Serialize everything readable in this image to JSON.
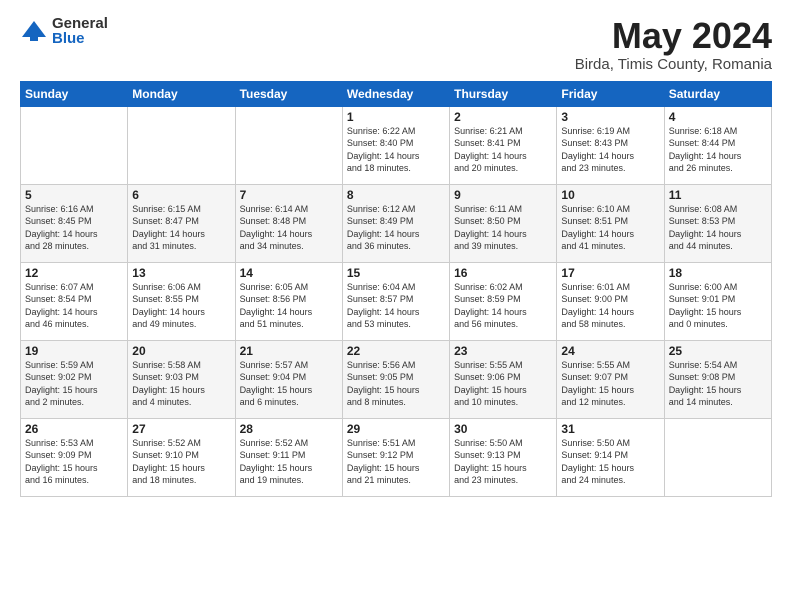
{
  "logo": {
    "general": "General",
    "blue": "Blue"
  },
  "title": "May 2024",
  "subtitle": "Birda, Timis County, Romania",
  "days_of_week": [
    "Sunday",
    "Monday",
    "Tuesday",
    "Wednesday",
    "Thursday",
    "Friday",
    "Saturday"
  ],
  "weeks": [
    [
      {
        "day": "",
        "info": ""
      },
      {
        "day": "",
        "info": ""
      },
      {
        "day": "",
        "info": ""
      },
      {
        "day": "1",
        "info": "Sunrise: 6:22 AM\nSunset: 8:40 PM\nDaylight: 14 hours\nand 18 minutes."
      },
      {
        "day": "2",
        "info": "Sunrise: 6:21 AM\nSunset: 8:41 PM\nDaylight: 14 hours\nand 20 minutes."
      },
      {
        "day": "3",
        "info": "Sunrise: 6:19 AM\nSunset: 8:43 PM\nDaylight: 14 hours\nand 23 minutes."
      },
      {
        "day": "4",
        "info": "Sunrise: 6:18 AM\nSunset: 8:44 PM\nDaylight: 14 hours\nand 26 minutes."
      }
    ],
    [
      {
        "day": "5",
        "info": "Sunrise: 6:16 AM\nSunset: 8:45 PM\nDaylight: 14 hours\nand 28 minutes."
      },
      {
        "day": "6",
        "info": "Sunrise: 6:15 AM\nSunset: 8:47 PM\nDaylight: 14 hours\nand 31 minutes."
      },
      {
        "day": "7",
        "info": "Sunrise: 6:14 AM\nSunset: 8:48 PM\nDaylight: 14 hours\nand 34 minutes."
      },
      {
        "day": "8",
        "info": "Sunrise: 6:12 AM\nSunset: 8:49 PM\nDaylight: 14 hours\nand 36 minutes."
      },
      {
        "day": "9",
        "info": "Sunrise: 6:11 AM\nSunset: 8:50 PM\nDaylight: 14 hours\nand 39 minutes."
      },
      {
        "day": "10",
        "info": "Sunrise: 6:10 AM\nSunset: 8:51 PM\nDaylight: 14 hours\nand 41 minutes."
      },
      {
        "day": "11",
        "info": "Sunrise: 6:08 AM\nSunset: 8:53 PM\nDaylight: 14 hours\nand 44 minutes."
      }
    ],
    [
      {
        "day": "12",
        "info": "Sunrise: 6:07 AM\nSunset: 8:54 PM\nDaylight: 14 hours\nand 46 minutes."
      },
      {
        "day": "13",
        "info": "Sunrise: 6:06 AM\nSunset: 8:55 PM\nDaylight: 14 hours\nand 49 minutes."
      },
      {
        "day": "14",
        "info": "Sunrise: 6:05 AM\nSunset: 8:56 PM\nDaylight: 14 hours\nand 51 minutes."
      },
      {
        "day": "15",
        "info": "Sunrise: 6:04 AM\nSunset: 8:57 PM\nDaylight: 14 hours\nand 53 minutes."
      },
      {
        "day": "16",
        "info": "Sunrise: 6:02 AM\nSunset: 8:59 PM\nDaylight: 14 hours\nand 56 minutes."
      },
      {
        "day": "17",
        "info": "Sunrise: 6:01 AM\nSunset: 9:00 PM\nDaylight: 14 hours\nand 58 minutes."
      },
      {
        "day": "18",
        "info": "Sunrise: 6:00 AM\nSunset: 9:01 PM\nDaylight: 15 hours\nand 0 minutes."
      }
    ],
    [
      {
        "day": "19",
        "info": "Sunrise: 5:59 AM\nSunset: 9:02 PM\nDaylight: 15 hours\nand 2 minutes."
      },
      {
        "day": "20",
        "info": "Sunrise: 5:58 AM\nSunset: 9:03 PM\nDaylight: 15 hours\nand 4 minutes."
      },
      {
        "day": "21",
        "info": "Sunrise: 5:57 AM\nSunset: 9:04 PM\nDaylight: 15 hours\nand 6 minutes."
      },
      {
        "day": "22",
        "info": "Sunrise: 5:56 AM\nSunset: 9:05 PM\nDaylight: 15 hours\nand 8 minutes."
      },
      {
        "day": "23",
        "info": "Sunrise: 5:55 AM\nSunset: 9:06 PM\nDaylight: 15 hours\nand 10 minutes."
      },
      {
        "day": "24",
        "info": "Sunrise: 5:55 AM\nSunset: 9:07 PM\nDaylight: 15 hours\nand 12 minutes."
      },
      {
        "day": "25",
        "info": "Sunrise: 5:54 AM\nSunset: 9:08 PM\nDaylight: 15 hours\nand 14 minutes."
      }
    ],
    [
      {
        "day": "26",
        "info": "Sunrise: 5:53 AM\nSunset: 9:09 PM\nDaylight: 15 hours\nand 16 minutes."
      },
      {
        "day": "27",
        "info": "Sunrise: 5:52 AM\nSunset: 9:10 PM\nDaylight: 15 hours\nand 18 minutes."
      },
      {
        "day": "28",
        "info": "Sunrise: 5:52 AM\nSunset: 9:11 PM\nDaylight: 15 hours\nand 19 minutes."
      },
      {
        "day": "29",
        "info": "Sunrise: 5:51 AM\nSunset: 9:12 PM\nDaylight: 15 hours\nand 21 minutes."
      },
      {
        "day": "30",
        "info": "Sunrise: 5:50 AM\nSunset: 9:13 PM\nDaylight: 15 hours\nand 23 minutes."
      },
      {
        "day": "31",
        "info": "Sunrise: 5:50 AM\nSunset: 9:14 PM\nDaylight: 15 hours\nand 24 minutes."
      },
      {
        "day": "",
        "info": ""
      }
    ]
  ]
}
